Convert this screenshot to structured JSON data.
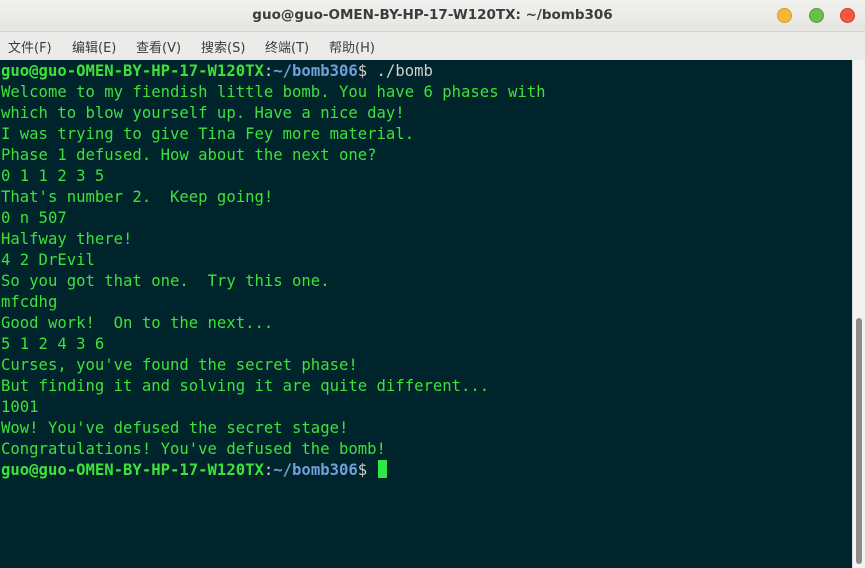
{
  "window": {
    "title": "guo@guo-OMEN-BY-HP-17-W120TX: ~/bomb306"
  },
  "menu": [
    {
      "label": "文件(F)"
    },
    {
      "label": "编辑(E)"
    },
    {
      "label": "查看(V)"
    },
    {
      "label": "搜索(S)"
    },
    {
      "label": "终端(T)"
    },
    {
      "label": "帮助(H)"
    }
  ],
  "prompt": {
    "user_host": "guo@guo-OMEN-BY-HP-17-W120TX",
    "colon": ":",
    "path": "~/bomb306",
    "symbol": "$ ",
    "command": "./bomb"
  },
  "output": [
    "Welcome to my fiendish little bomb. You have 6 phases with",
    "which to blow yourself up. Have a nice day!",
    "I was trying to give Tina Fey more material.",
    "Phase 1 defused. How about the next one?",
    "0 1 1 2 3 5",
    "That's number 2.  Keep going!",
    "0 n 507",
    "Halfway there!",
    "4 2 DrEvil",
    "So you got that one.  Try this one.",
    "mfcdhg",
    "Good work!  On to the next...",
    "5 1 2 4 3 6",
    "Curses, you've found the secret phase!",
    "But finding it and solving it are quite different...",
    "1001",
    "Wow! You've defused the secret stage!",
    "Congratulations! You've defused the bomb!"
  ],
  "colors": {
    "terminal_bg": "#00242c",
    "output_text": "#3ee13a",
    "path_text": "#6f9fd9",
    "cursor": "#2ee84a",
    "close_button": "#ee5b42",
    "minimize_button": "#f4b73b",
    "maximize_button": "#67c146"
  },
  "icons": {
    "minimize": "minimize-icon",
    "maximize": "maximize-icon",
    "close": "close-icon"
  }
}
